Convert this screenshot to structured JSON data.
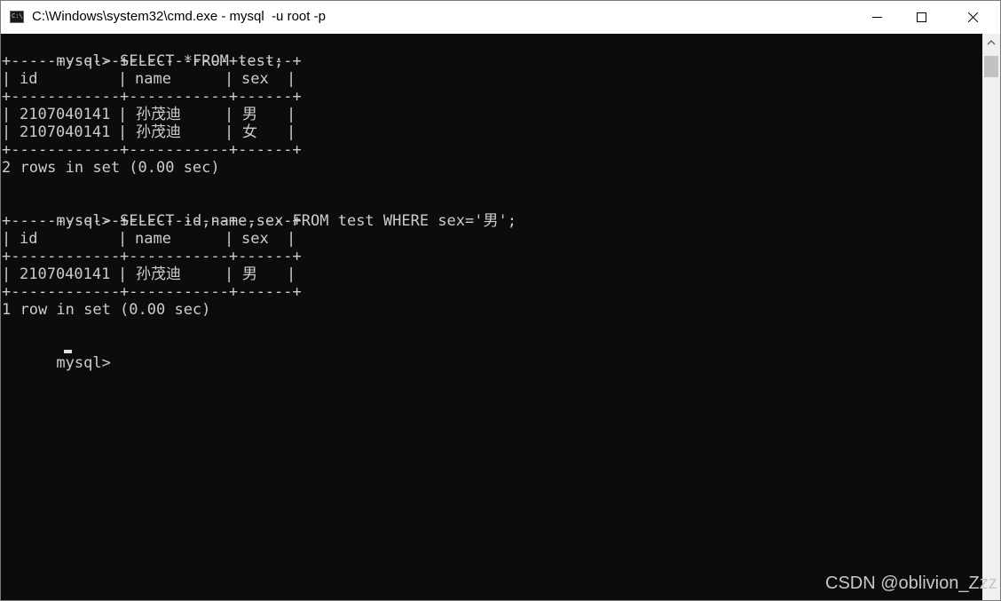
{
  "window": {
    "title": "C:\\Windows\\system32\\cmd.exe - mysql  -u root -p",
    "app_icon_text": "C:\\.",
    "controls": [
      "minimize",
      "maximize",
      "close"
    ]
  },
  "console": {
    "prompt": "mysql>",
    "query1": "SELECT *FROM test;",
    "table1": {
      "border": "+------------+-----------+------+",
      "headers": [
        "id",
        "name",
        "sex"
      ],
      "rows": [
        [
          "2107040141",
          "孙茂迪",
          "男"
        ],
        [
          "2107040141",
          "孙茂迪",
          "女"
        ]
      ]
    },
    "result1": "2 rows in set (0.00 sec)",
    "query2": "SELECT id,name,sex FROM test WHERE sex='男';",
    "table2": {
      "border": "+------------+-----------+------+",
      "headers": [
        "id",
        "name",
        "sex"
      ],
      "rows": [
        [
          "2107040141",
          "孙茂迪",
          "男"
        ]
      ]
    },
    "result2": "1 row in set (0.00 sec)",
    "current_input": ""
  },
  "watermark": "CSDN @oblivion_Zzz",
  "colors": {
    "console_bg": "#0c0c0c",
    "console_text": "#cccccc",
    "titlebar_bg": "#ffffff"
  },
  "icons": {
    "app": "cmd-console-icon",
    "minimize": "minimize-icon",
    "maximize": "maximize-icon",
    "close": "close-icon",
    "scroll_up": "arrow-up-icon"
  }
}
